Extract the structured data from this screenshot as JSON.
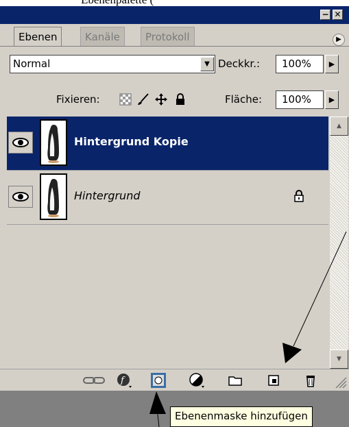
{
  "caption_fragment": "Ebenenpalette (",
  "window": {
    "minimize_glyph": "−",
    "close_glyph": "✕"
  },
  "tabs": [
    {
      "label": "Ebenen",
      "active": true
    },
    {
      "label": "Kanäle",
      "active": false
    },
    {
      "label": "Protokoll",
      "active": false
    }
  ],
  "blend_mode": {
    "value": "Normal"
  },
  "opacity": {
    "label": "Deckkr.:",
    "value": "100%"
  },
  "lock": {
    "label": "Fixieren:",
    "icons": [
      "lock-transparent-icon",
      "lock-paint-icon",
      "lock-move-icon",
      "lock-all-icon"
    ]
  },
  "fill": {
    "label": "Fläche:",
    "value": "100%"
  },
  "layers": [
    {
      "name": "Hintergrund Kopie",
      "selected": true,
      "visible": true,
      "locked": false
    },
    {
      "name": "Hintergrund",
      "selected": false,
      "visible": true,
      "locked": true
    }
  ],
  "bottom_icons": [
    "link-icon",
    "layer-style-icon",
    "layer-mask-icon",
    "adjustment-layer-icon",
    "folder-icon",
    "new-layer-icon",
    "trash-icon"
  ],
  "tooltip": {
    "text": "Ebenenmaske hinzufügen"
  },
  "colors": {
    "selection": "#0a246a",
    "panel": "#d4d0c8",
    "tooltip": "#ffffe1"
  }
}
